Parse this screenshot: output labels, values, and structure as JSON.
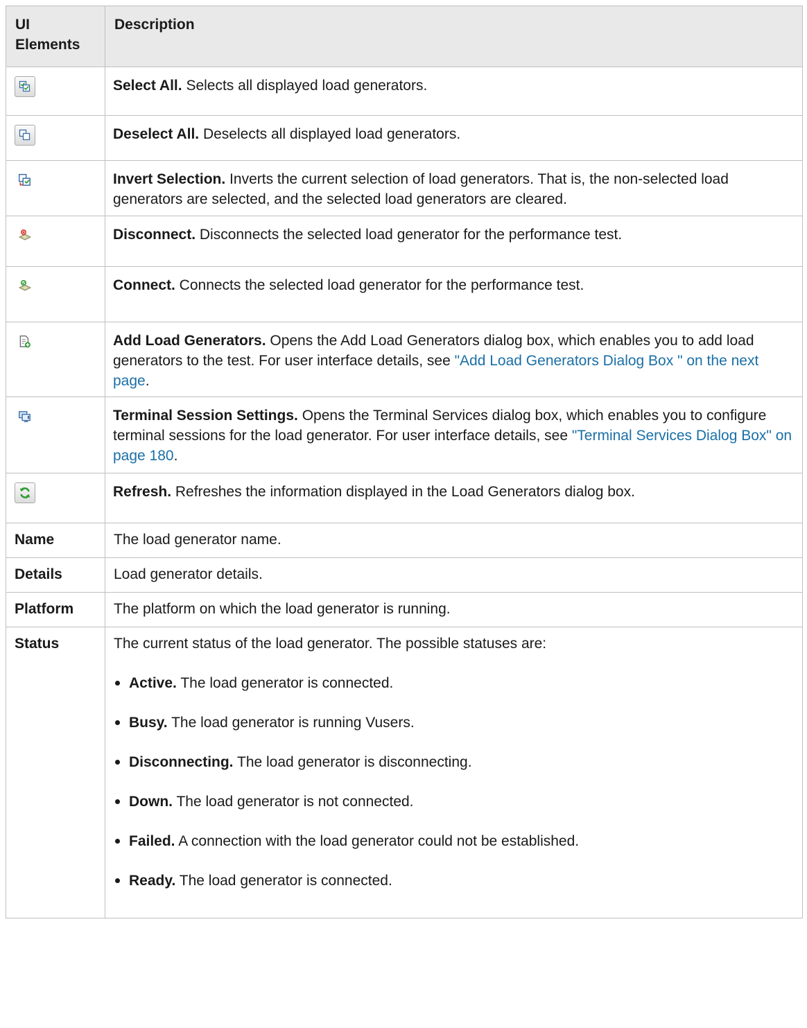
{
  "header": {
    "col1": "UI Elements",
    "col2": "Description"
  },
  "rows": [
    {
      "icon": "select-all-icon",
      "label": "Select All.",
      "text": " Selects all displayed load generators."
    },
    {
      "icon": "deselect-all-icon",
      "label": "Deselect All.",
      "text": " Deselects all displayed load generators."
    },
    {
      "icon": "invert-selection-icon",
      "label": "Invert Selection.",
      "text": " Inverts the current selection of load generators. That is, the non-selected load generators are selected, and the selected load generators are cleared."
    },
    {
      "icon": "disconnect-icon",
      "label": "Disconnect.",
      "text": " Disconnects the selected load generator for the performance test."
    },
    {
      "icon": "connect-icon",
      "label": "Connect.",
      "text": " Connects the selected load generator for the performance test."
    },
    {
      "icon": "add-load-generators-icon",
      "label": "Add Load Generators.",
      "text": " Opens the Add Load Generators dialog box, which enables you to add load generators to the test. For user interface details, see ",
      "link": "\"Add Load Generators Dialog Box \" on the next page",
      "after": "."
    },
    {
      "icon": "terminal-session-icon",
      "label": "Terminal Session Settings.",
      "text": " Opens the Terminal Services dialog box, which enables you to configure terminal sessions for the load generator. For user interface details, see ",
      "link": "\"Terminal Services Dialog Box\" on page 180",
      "after": "."
    },
    {
      "icon": "refresh-icon",
      "label": "Refresh.",
      "text": " Refreshes the information displayed in the Load Generators dialog box."
    }
  ],
  "fields": [
    {
      "name": "Name",
      "desc": "The load generator name."
    },
    {
      "name": "Details",
      "desc": "Load generator details."
    },
    {
      "name": "Platform",
      "desc": "The platform on which the load generator is running."
    }
  ],
  "status": {
    "name": "Status",
    "intro": "The current status of the load generator. The possible statuses are:",
    "items": [
      {
        "label": "Active.",
        "text": " The load generator is connected."
      },
      {
        "label": "Busy.",
        "text": " The load generator is running Vusers."
      },
      {
        "label": "Disconnecting.",
        "text": " The load generator is disconnecting."
      },
      {
        "label": "Down.",
        "text": " The load generator is not connected."
      },
      {
        "label": "Failed.",
        "text": " A connection with the load generator could not be established."
      },
      {
        "label": "Ready.",
        "text": " The load generator is connected."
      }
    ]
  },
  "colors": {
    "link": "#1a6fa6",
    "header_bg": "#e9e9e9",
    "border": "#bfbfbf"
  }
}
